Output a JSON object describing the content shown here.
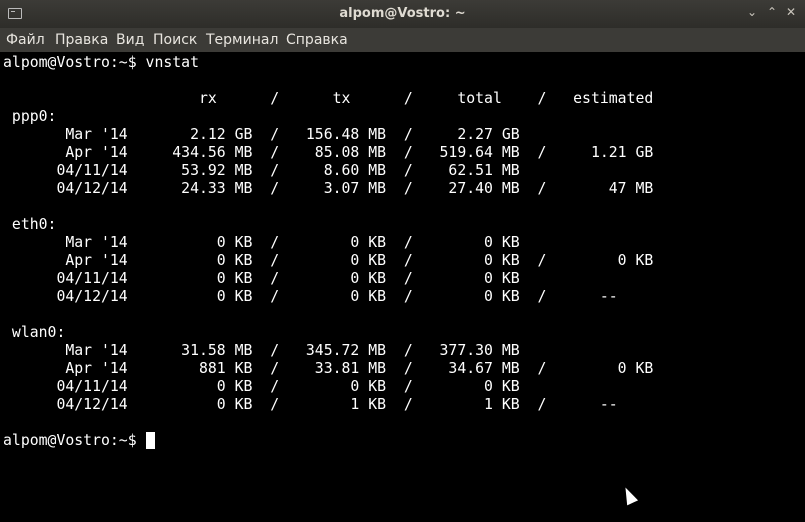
{
  "window": {
    "title": "alpom@Vostro: ~",
    "minimize_glyph": "⌄",
    "maximize_glyph": "⌃",
    "close_glyph": "✕"
  },
  "menu": {
    "items": [
      "Файл",
      "Правка",
      "Вид",
      "Поиск",
      "Терминал",
      "Справка"
    ]
  },
  "terminal": {
    "lines": [
      "alpom@Vostro:~$ vnstat",
      "",
      "                      rx      /      tx      /     total    /   estimated",
      " ppp0:",
      "       Mar '14       2.12 GB  /   156.48 MB  /     2.27 GB",
      "       Apr '14     434.56 MB  /    85.08 MB  /   519.64 MB  /     1.21 GB",
      "      04/11/14      53.92 MB  /     8.60 MB  /    62.51 MB",
      "      04/12/14      24.33 MB  /     3.07 MB  /    27.40 MB  /       47 MB",
      "",
      " eth0:",
      "       Mar '14          0 KB  /        0 KB  /        0 KB",
      "       Apr '14          0 KB  /        0 KB  /        0 KB  /        0 KB",
      "      04/11/14          0 KB  /        0 KB  /        0 KB",
      "      04/12/14          0 KB  /        0 KB  /        0 KB  /      --",
      "",
      " wlan0:",
      "       Mar '14      31.58 MB  /   345.72 MB  /   377.30 MB",
      "       Apr '14        881 KB  /    33.81 MB  /    34.67 MB  /        0 KB",
      "      04/11/14          0 KB  /        0 KB  /        0 KB",
      "      04/12/14          0 KB  /        1 KB  /        1 KB  /      --",
      "",
      "alpom@Vostro:~$ "
    ]
  }
}
